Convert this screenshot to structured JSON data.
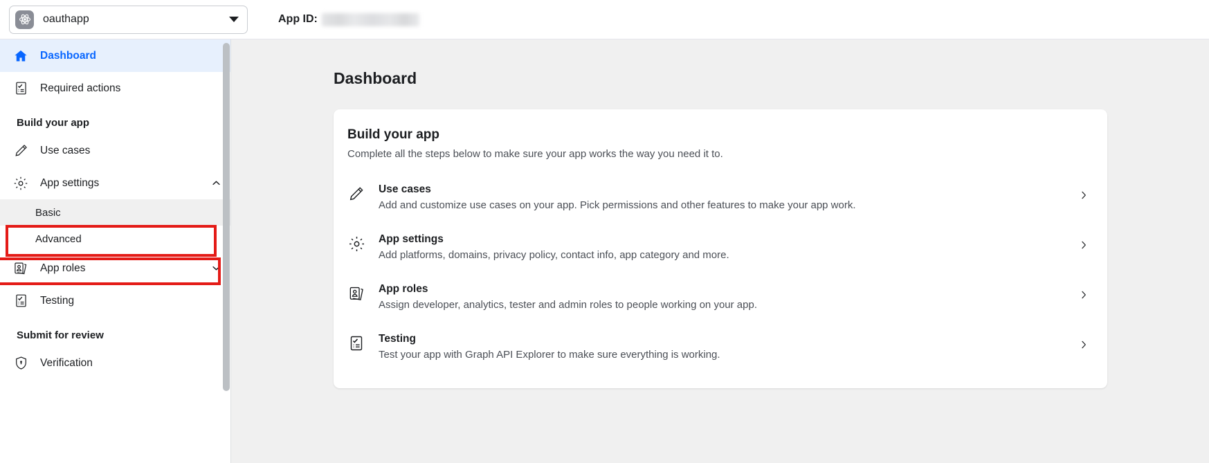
{
  "topbar": {
    "app_name": "oauthapp",
    "app_icon": "atom-icon",
    "dropdown_icon": "caret-down-icon",
    "app_id_label": "App ID:",
    "app_id_value": ""
  },
  "sidebar": {
    "items": [
      {
        "label": "Dashboard",
        "icon": "home-icon",
        "active": true,
        "type": "item"
      },
      {
        "label": "Required actions",
        "icon": "checklist-icon",
        "active": false,
        "type": "item"
      }
    ],
    "section_build": "Build your app",
    "build_items": [
      {
        "label": "Use cases",
        "icon": "pencil-icon",
        "chevron": ""
      },
      {
        "label": "App settings",
        "icon": "gear-icon",
        "chevron": "chevron-up-icon"
      }
    ],
    "sub_items": [
      {
        "label": "Basic",
        "selected": true
      },
      {
        "label": "Advanced",
        "selected": false
      }
    ],
    "build_items_2": [
      {
        "label": "App roles",
        "icon": "id-cards-icon",
        "chevron": "chevron-down-icon"
      },
      {
        "label": "Testing",
        "icon": "checklist-icon",
        "chevron": ""
      }
    ],
    "section_submit": "Submit for review",
    "submit_items": [
      {
        "label": "Verification",
        "icon": "shield-lock-icon"
      }
    ]
  },
  "main": {
    "page_title": "Dashboard",
    "card": {
      "title": "Build your app",
      "subtitle": "Complete all the steps below to make sure your app works the way you need it to.",
      "rows": [
        {
          "icon": "pencil-icon",
          "title": "Use cases",
          "desc": "Add and customize use cases on your app. Pick permissions and other features to make your app work.",
          "chevron": "chevron-right-icon"
        },
        {
          "icon": "gear-icon",
          "title": "App settings",
          "desc": "Add platforms, domains, privacy policy, contact info, app category and more.",
          "chevron": "chevron-right-icon"
        },
        {
          "icon": "id-cards-icon",
          "title": "App roles",
          "desc": "Assign developer, analytics, tester and admin roles to people working on your app.",
          "chevron": "chevron-right-icon"
        },
        {
          "icon": "checklist-icon",
          "title": "Testing",
          "desc": "Test your app with Graph API Explorer to make sure everything is working.",
          "chevron": "chevron-right-icon"
        }
      ]
    }
  },
  "annotations": [
    {
      "name": "app-settings-highlight",
      "color": "#e41b17"
    },
    {
      "name": "basic-highlight",
      "color": "#e41b17"
    }
  ],
  "colors": {
    "accent_blue": "#0866ff",
    "active_bg": "#e7f0fd",
    "annotation_red": "#e41b17",
    "page_bg": "#f0f0f0"
  }
}
